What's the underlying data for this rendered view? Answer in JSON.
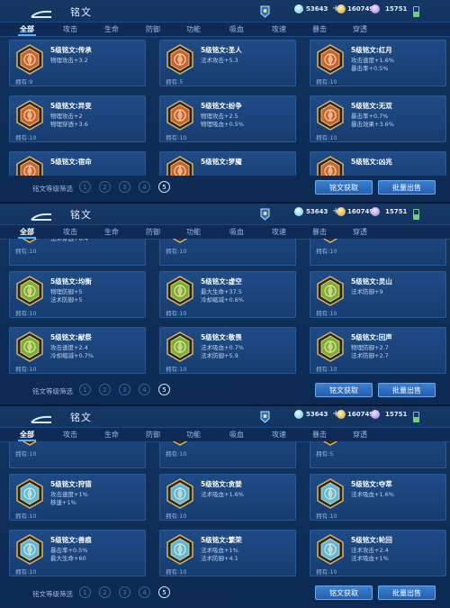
{
  "header": {
    "title": "铭文",
    "resource1": "53643",
    "resource2": "160749",
    "resource3": "15751"
  },
  "tabs": [
    "全部",
    "攻击",
    "生命",
    "防御",
    "功能",
    "吸血",
    "攻速",
    "暴击",
    "穿透"
  ],
  "footer": {
    "filter_label": "铭文等级筛选",
    "levels": [
      "1",
      "2",
      "3",
      "4",
      "5"
    ],
    "obtain_button": "铭文获取",
    "sell_button": "批量出售"
  },
  "colors": {
    "accent": "#4fb2ff",
    "card": "#1f4b86"
  },
  "screens": [
    {
      "rows": [
        [
          {
            "name": "5级铭文:传承",
            "a1": "物理攻击+3.2",
            "a2": "",
            "owned": "拥有:9",
            "color": "#c9632a"
          },
          {
            "name": "5级铭文:圣人",
            "a1": "法术攻击+5.3",
            "a2": "",
            "owned": "拥有:5",
            "color": "#c9632a"
          },
          {
            "name": "5级铭文:红月",
            "a1": "攻击速度+1.6%",
            "a2": "暴击率+0.5%",
            "owned": "拥有:10",
            "color": "#c9632a"
          }
        ],
        [
          {
            "name": "5级铭文:异变",
            "a1": "物理攻击+2",
            "a2": "物理穿透+3.6",
            "owned": "拥有:10",
            "color": "#c9632a"
          },
          {
            "name": "5级铭文:纷争",
            "a1": "物理攻击+2.5",
            "a2": "物理吸血+0.5%",
            "owned": "拥有:10",
            "color": "#c9632a"
          },
          {
            "name": "5级铭文:无双",
            "a1": "暴击率+0.7%",
            "a2": "暴击效果+3.6%",
            "owned": "拥有:10",
            "color": "#c9632a"
          }
        ],
        [
          {
            "name": "5级铭文:宿命",
            "a1": "",
            "a2": "",
            "owned": "",
            "color": "#c9632a"
          },
          {
            "name": "5级铭文:梦魇",
            "a1": "",
            "a2": "",
            "owned": "",
            "color": "#c9632a"
          },
          {
            "name": "5级铭文:凶兆",
            "a1": "",
            "a2": "",
            "owned": "",
            "color": "#c9632a"
          }
        ]
      ]
    },
    {
      "top_partial": [
        {
          "a1": "攻击速度+0.6%",
          "a2": "法术穿透+6.4",
          "owned": "拥有:10"
        },
        {
          "a1": "冷却缩减+1%",
          "a2": "",
          "owned": "拥有:10"
        },
        {
          "a1": "物理防御+9",
          "a2": "",
          "owned": "拥有:10"
        }
      ],
      "rows": [
        [
          {
            "name": "5级铭文:均衡",
            "a1": "物理防御+5",
            "a2": "法术防御+5",
            "owned": "拥有:10",
            "color": "#7fae2f"
          },
          {
            "name": "5级铭文:虚空",
            "a1": "最大生命+37.5",
            "a2": "冷却缩减+0.6%",
            "owned": "拥有:10",
            "color": "#7fae2f"
          },
          {
            "name": "5级铭文:灵山",
            "a1": "法术防御+9",
            "a2": "",
            "owned": "拥有:10",
            "color": "#7fae2f"
          }
        ],
        [
          {
            "name": "5级铭文:献祭",
            "a1": "攻击速度+2.4",
            "a2": "冷却缩减+0.7%",
            "owned": "拥有:10",
            "color": "#7fae2f"
          },
          {
            "name": "5级铭文:敬畏",
            "a1": "法术吸血+0.7%",
            "a2": "法术防御+5.9",
            "owned": "拥有:10",
            "color": "#7fae2f"
          },
          {
            "name": "5级铭文:回声",
            "a1": "物理防御+2.7",
            "a2": "法术防御+2.7",
            "owned": "拥有:10",
            "color": "#7fae2f"
          }
        ]
      ]
    },
    {
      "top_partial": [
        {
          "a1": "",
          "a2": "",
          "owned": "拥有:10"
        },
        {
          "a1": "",
          "a2": "",
          "owned": "拥有:10"
        },
        {
          "a1": "",
          "a2": "",
          "owned": "拥有:5"
        }
      ],
      "rows": [
        [
          {
            "name": "5级铭文:狩猎",
            "a1": "攻击速度+1%",
            "a2": "移速+1%",
            "owned": "拥有:10",
            "color": "#5fb8d8"
          },
          {
            "name": "5级铭文:贪婪",
            "a1": "法术吸血+1.6%",
            "a2": "",
            "owned": "拥有:10",
            "color": "#5fb8d8"
          },
          {
            "name": "5级铭文:夺萃",
            "a1": "法术吸血+1.6%",
            "a2": "",
            "owned": "拥有:10",
            "color": "#5fb8d8"
          }
        ],
        [
          {
            "name": "5级铭文:兽痕",
            "a1": "暴击率+0.5%",
            "a2": "最大生命+60",
            "owned": "拥有:10",
            "color": "#5fb8d8"
          },
          {
            "name": "5级铭文:繁荣",
            "a1": "法术吸血+1%",
            "a2": "法术防御+4.1",
            "owned": "拥有:10",
            "color": "#5fb8d8"
          },
          {
            "name": "5级铭文:轮回",
            "a1": "法术攻击+2.4",
            "a2": "法术吸血+1%",
            "owned": "拥有:10",
            "color": "#5fb8d8"
          }
        ]
      ]
    }
  ]
}
